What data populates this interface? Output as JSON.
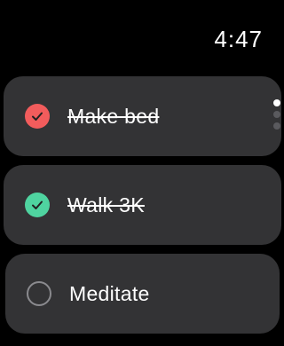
{
  "status_bar": {
    "time": "4:47"
  },
  "tasks": [
    {
      "label": "Make bed",
      "completed": true,
      "check_color": "#f25c5c"
    },
    {
      "label": "Walk 3K",
      "completed": true,
      "check_color": "#4fd4a0"
    },
    {
      "label": "Meditate",
      "completed": false,
      "check_color": "#8a8a8e"
    }
  ],
  "page_indicator": {
    "pages": 3,
    "current": 1
  },
  "colors": {
    "background": "#000000",
    "card": "#333335",
    "text": "#ffffff"
  }
}
